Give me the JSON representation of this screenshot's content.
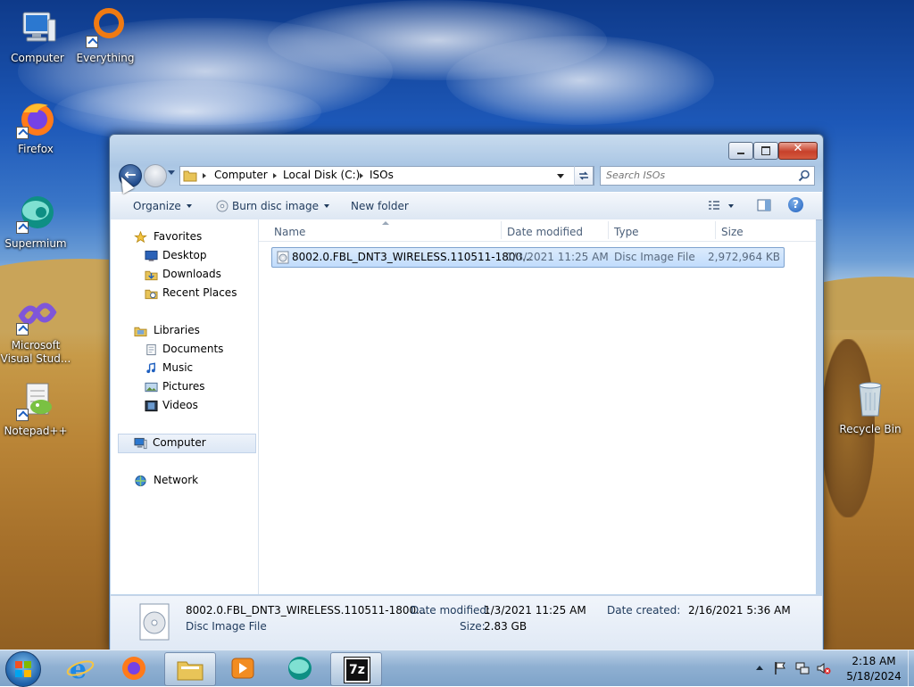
{
  "desktop": {
    "icons": [
      {
        "label": "Computer"
      },
      {
        "label": "Everything"
      },
      {
        "label": "Firefox"
      },
      {
        "label": "Supermium"
      },
      {
        "label": "Microsoft Visual Stud..."
      },
      {
        "label": "Notepad++"
      },
      {
        "label": "Recycle Bin"
      }
    ]
  },
  "window": {
    "breadcrumb": [
      "Computer",
      "Local Disk (C:)",
      "ISOs"
    ],
    "search_placeholder": "Search ISOs",
    "toolbar": {
      "organize": "Organize",
      "burn": "Burn disc image",
      "new_folder": "New folder"
    },
    "nav": {
      "favorites": "Favorites",
      "desktop": "Desktop",
      "downloads": "Downloads",
      "recent": "Recent Places",
      "libraries": "Libraries",
      "documents": "Documents",
      "music": "Music",
      "pictures": "Pictures",
      "videos": "Videos",
      "computer": "Computer",
      "network": "Network"
    },
    "columns": {
      "name": "Name",
      "date": "Date modified",
      "type": "Type",
      "size": "Size"
    },
    "files": [
      {
        "name": "8002.0.FBL_DNT3_WIRELESS.110511-1800...",
        "date": "1/3/2021 11:25 AM",
        "type": "Disc Image File",
        "size": "2,972,964 KB"
      }
    ],
    "details": {
      "name": "8002.0.FBL_DNT3_WIRELESS.110511-1800...",
      "type": "Disc Image File",
      "modified_label": "Date modified:",
      "modified_value": "1/3/2021 11:25 AM",
      "size_label": "Size:",
      "size_value": "2.83 GB",
      "created_label": "Date created:",
      "created_value": "2/16/2021 5:36 AM"
    }
  },
  "taskbar": {
    "clock_time": "2:18 AM",
    "clock_date": "5/18/2024",
    "seven_zip_label": "7z"
  }
}
